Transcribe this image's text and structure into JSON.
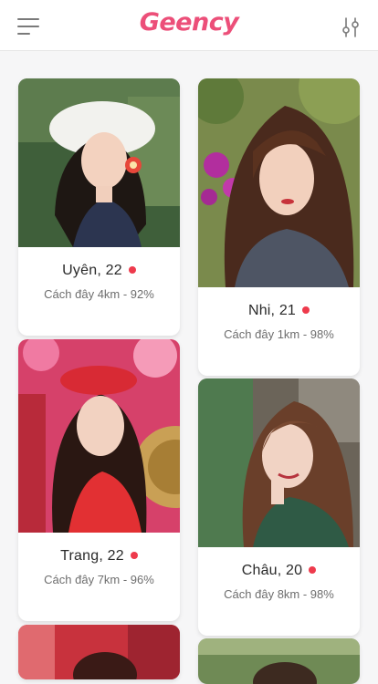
{
  "app": {
    "brand": "Geency",
    "brand_color": "#ec4f79",
    "online_dot_color": "#ee3a4c",
    "menu_icon": "hamburger-menu-icon",
    "filter_icon": "sliders-filter-icon"
  },
  "profiles": [
    {
      "name": "Uyên, 22",
      "meta": "Cách đây 4km - 92%"
    },
    {
      "name": "Nhi, 21",
      "meta": "Cách đây 1km - 98%"
    },
    {
      "name": "Trang, 22",
      "meta": "Cách đây 7km - 96%"
    },
    {
      "name": "Châu, 20",
      "meta": "Cách đây 8km - 98%"
    }
  ]
}
